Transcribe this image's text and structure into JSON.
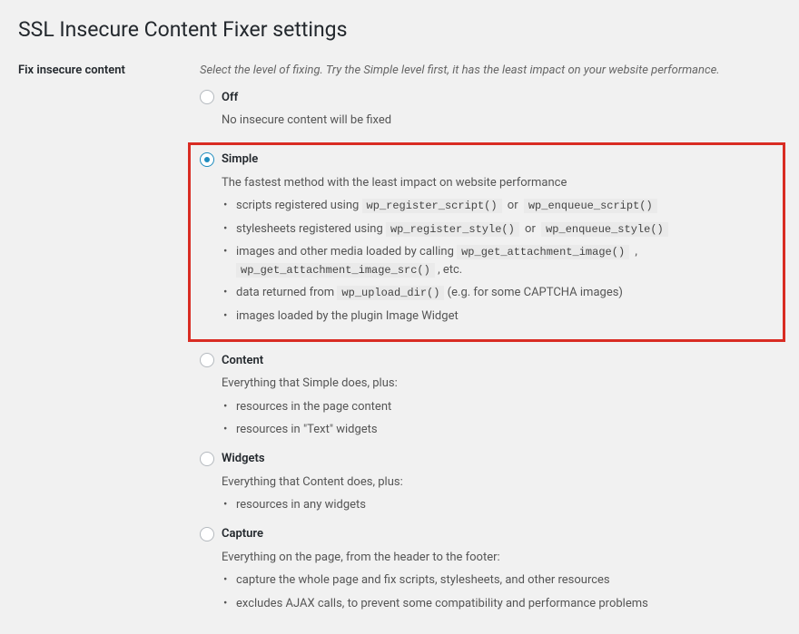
{
  "page_title": "SSL Insecure Content Fixer settings",
  "section": {
    "label": "Fix insecure content",
    "description": "Select the level of fixing. Try the Simple level first, it has the least impact on your website performance."
  },
  "options": {
    "off": {
      "label": "Off",
      "desc": "No insecure content will be fixed"
    },
    "simple": {
      "label": "Simple",
      "desc": "The fastest method with the least impact on website performance",
      "bullets": {
        "b0_pre": "scripts registered using ",
        "b0_code1": "wp_register_script()",
        "b0_sep": " or ",
        "b0_code2": "wp_enqueue_script()",
        "b1_pre": "stylesheets registered using ",
        "b1_code1": "wp_register_style()",
        "b1_sep": " or ",
        "b1_code2": "wp_enqueue_style()",
        "b2_pre": "images and other media loaded by calling ",
        "b2_code1": "wp_get_attachment_image()",
        "b2_sep": " , ",
        "b2_code2": "wp_get_attachment_image_src()",
        "b2_post": " , etc.",
        "b3_pre": "data returned from ",
        "b3_code1": "wp_upload_dir()",
        "b3_post": " (e.g. for some CAPTCHA images)",
        "b4": "images loaded by the plugin Image Widget"
      }
    },
    "content": {
      "label": "Content",
      "desc": "Everything that Simple does, plus:",
      "bullets": {
        "b0": "resources in the page content",
        "b1": "resources in \"Text\" widgets"
      }
    },
    "widgets": {
      "label": "Widgets",
      "desc": "Everything that Content does, plus:",
      "bullets": {
        "b0": "resources in any widgets"
      }
    },
    "capture": {
      "label": "Capture",
      "desc": "Everything on the page, from the header to the footer:",
      "bullets": {
        "b0": "capture the whole page and fix scripts, stylesheets, and other resources",
        "b1": "excludes AJAX calls, to prevent some compatibility and performance problems"
      }
    }
  }
}
